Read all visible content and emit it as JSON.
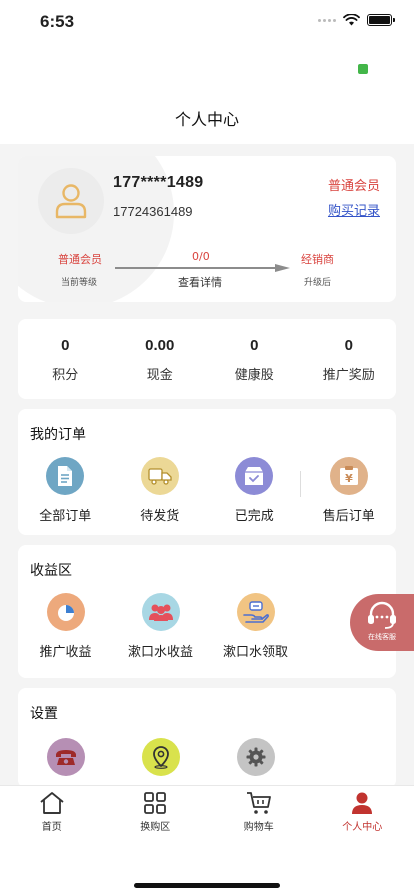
{
  "status_bar": {
    "time": "6:53"
  },
  "header": {
    "title": "个人中心"
  },
  "profile": {
    "username": "177****1489",
    "user_id": "17724361489",
    "member_level": "普通会员",
    "buy_record_link": "购买记录",
    "level_current": "普通会员",
    "level_current_caption": "当前等级",
    "level_progress": "0/0",
    "level_detail_link": "查看详情",
    "level_next": "经销商",
    "level_next_caption": "升级后"
  },
  "stats": [
    {
      "value": "0",
      "label": "积分"
    },
    {
      "value": "0.00",
      "label": "现金"
    },
    {
      "value": "0",
      "label": "健康股"
    },
    {
      "value": "0",
      "label": "推广奖励"
    }
  ],
  "orders": {
    "title": "我的订单",
    "items": [
      {
        "label": "全部订单",
        "icon": "document-icon",
        "color": "#6fa6c4"
      },
      {
        "label": "待发货",
        "icon": "truck-icon",
        "color": "#ecd896"
      },
      {
        "label": "已完成",
        "icon": "box-check-icon",
        "color": "#8c8bd6"
      },
      {
        "label": "售后订单",
        "icon": "yen-box-icon",
        "color": "#e0b28a"
      }
    ]
  },
  "earnings": {
    "title": "收益区",
    "items": [
      {
        "label": "推广收益",
        "icon": "pie-chart-icon",
        "color": "#eda97c"
      },
      {
        "label": "漱口水收益",
        "icon": "people-icon",
        "color": "#a8d7e4"
      },
      {
        "label": "漱口水领取",
        "icon": "hand-receive-icon",
        "color": "#f1c483"
      }
    ]
  },
  "settings": {
    "title": "设置",
    "items": [
      {
        "icon": "telephone-icon",
        "color": "#b68fb4"
      },
      {
        "icon": "location-pin-icon",
        "color": "#d9e24c"
      },
      {
        "icon": "gear-icon",
        "color": "#c4c4c4"
      }
    ]
  },
  "customer_service": {
    "label": "在线客服"
  },
  "tabbar": [
    {
      "label": "首页",
      "icon": "home-icon"
    },
    {
      "label": "换购区",
      "icon": "grid-icon"
    },
    {
      "label": "购物车",
      "icon": "cart-icon"
    },
    {
      "label": "个人中心",
      "icon": "person-icon",
      "active": true
    }
  ],
  "colors": {
    "accent_red": "#d9443f",
    "link_blue": "#3454c8",
    "active_tab": "#c1332f"
  }
}
